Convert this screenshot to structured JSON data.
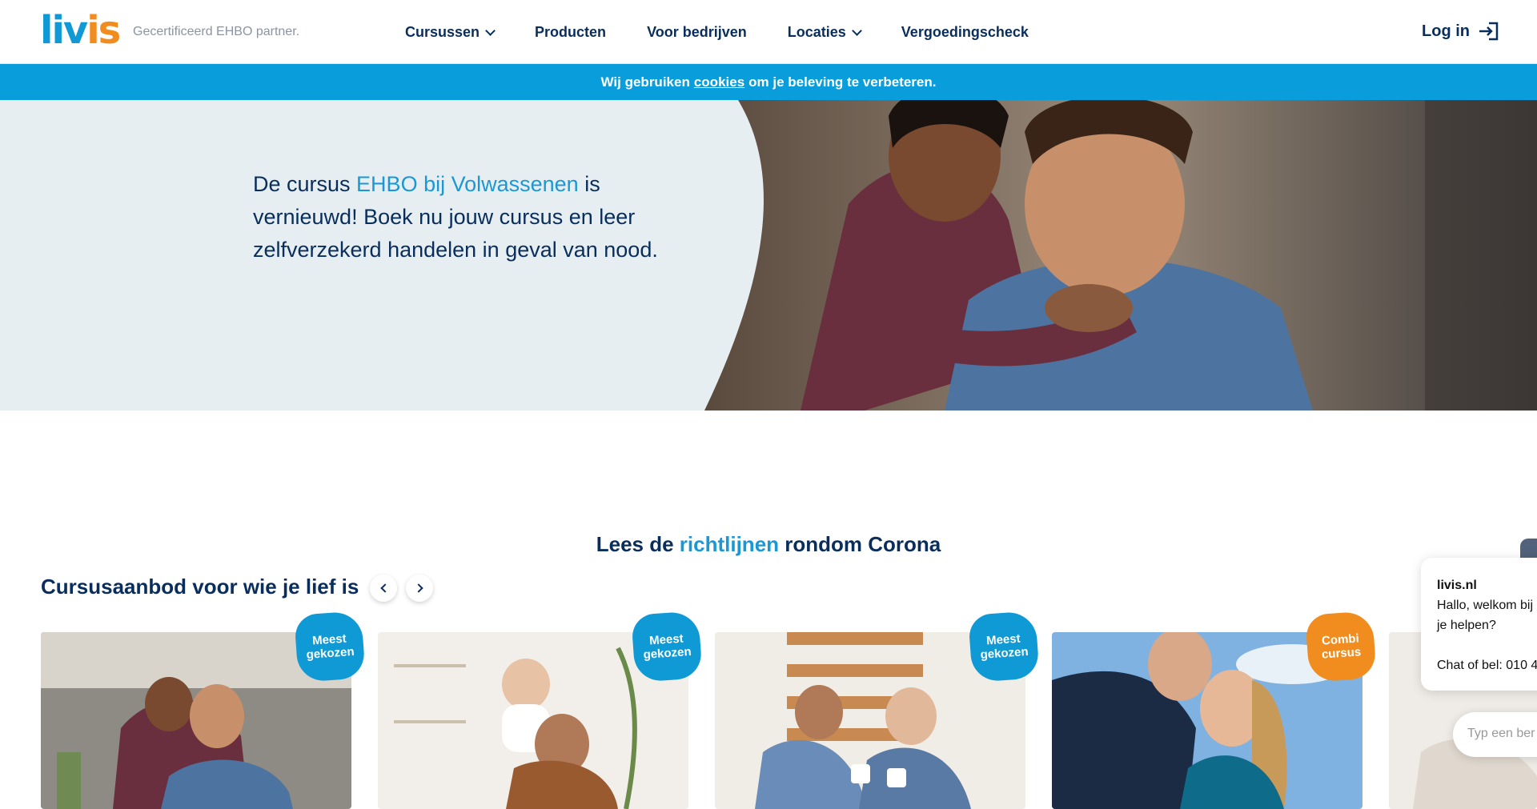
{
  "brand": {
    "logo_part1": "liv",
    "logo_part2": "is",
    "tagline": "Gecertificeerd EHBO partner."
  },
  "nav": {
    "items": [
      {
        "label": "Cursussen",
        "has_dropdown": true
      },
      {
        "label": "Producten",
        "has_dropdown": false
      },
      {
        "label": "Voor bedrijven",
        "has_dropdown": false
      },
      {
        "label": "Locaties",
        "has_dropdown": true
      },
      {
        "label": "Vergoedingscheck",
        "has_dropdown": false
      }
    ],
    "login_label": "Log in"
  },
  "cookie_bar": {
    "before": "Wij gebruiken",
    "link": "cookies",
    "after": "om je beleving te verbeteren."
  },
  "hero": {
    "text_before": "De cursus ",
    "highlight": "EHBO bij Volwassenen",
    "text_after": " is vernieuwd! Boek nu jouw cursus en leer zelfverzekerd handelen in geval van nood."
  },
  "corona": {
    "before": "Lees de ",
    "link": "richtlijnen",
    "after": " rondom Corona"
  },
  "courses": {
    "title": "Cursusaanbod voor wie je lief is",
    "cards": [
      {
        "badge_line1": "Meest",
        "badge_line2": "gekozen",
        "badge_color": "#0f9ad6"
      },
      {
        "badge_line1": "Meest",
        "badge_line2": "gekozen",
        "badge_color": "#0f9ad6"
      },
      {
        "badge_line1": "Meest",
        "badge_line2": "gekozen",
        "badge_color": "#0f9ad6"
      },
      {
        "badge_line1": "Combi",
        "badge_line2": "cursus",
        "badge_color": "#f18d1f"
      }
    ]
  },
  "chat": {
    "title": "livis.nl",
    "greeting_line1": "Hallo, welkom bij",
    "greeting_line2": "je helpen?",
    "phone_text": "Chat of bel: 010 4",
    "input_placeholder": "Typ een ber"
  },
  "colors": {
    "navy": "#0a2e5c",
    "brand_blue": "#0f9ad6",
    "brand_orange": "#f18d1f",
    "hero_bg": "#e7eef2"
  }
}
